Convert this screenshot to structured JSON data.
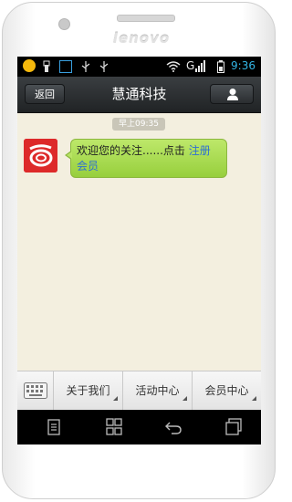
{
  "device": {
    "brand": "lenovo"
  },
  "status_bar": {
    "time": "9:36",
    "network": "G",
    "icons": [
      "emoji-icon",
      "usb-icon",
      "app-icon",
      "usb-debug-icon",
      "usb-storage-icon",
      "wifi-icon",
      "signal-icon",
      "battery-icon"
    ]
  },
  "header": {
    "back_label": "返回",
    "title": "慧通科技",
    "profile_icon": "person-icon"
  },
  "chat": {
    "time_label": "早上09:35",
    "messages": [
      {
        "sender_avatar": "company-logo",
        "text": "欢迎您的关注......点击 ",
        "link_text": "注册会员"
      }
    ]
  },
  "menu": {
    "keyboard_icon": "keyboard-icon",
    "items": [
      {
        "label": "关于我们"
      },
      {
        "label": "活动中心"
      },
      {
        "label": "会员中心"
      }
    ]
  },
  "nav": {
    "icons": [
      "menu-icon",
      "home-grid-icon",
      "back-icon",
      "recent-apps-icon"
    ]
  },
  "colors": {
    "chat_bg": "#f3efdf",
    "bubble_green": "#a6d94b",
    "link_blue": "#2f6fd2",
    "clock_blue": "#33b5e5",
    "titlebar": "#2b2e31"
  }
}
